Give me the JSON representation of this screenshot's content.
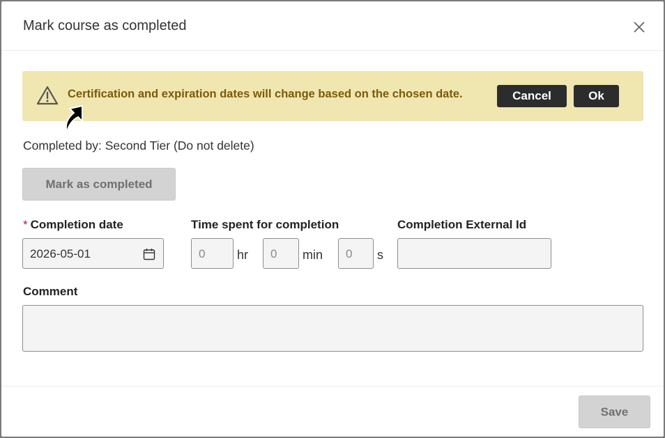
{
  "dialog": {
    "title": "Mark course as completed",
    "close_icon": "close-icon"
  },
  "alert": {
    "icon": "warning-triangle-icon",
    "message": "Certification and expiration dates will change based on the chosen date.",
    "cancel_label": "Cancel",
    "ok_label": "Ok",
    "background_color": "#f0e6b0",
    "text_color": "#7a5b08"
  },
  "completed_by": "Completed by: Second Tier (Do not delete)",
  "mark_completed_label": "Mark as completed",
  "completion_date": {
    "required_marker": "*",
    "label": "Completion date",
    "value": "2026-05-01",
    "icon": "calendar-icon"
  },
  "time_spent": {
    "label": "Time spent for completion",
    "hours": {
      "placeholder": "0",
      "unit": "hr"
    },
    "minutes": {
      "placeholder": "0",
      "unit": "min"
    },
    "seconds": {
      "placeholder": "0",
      "unit": "s"
    }
  },
  "external_id": {
    "label": "Completion External Id",
    "value": ""
  },
  "comment": {
    "label": "Comment",
    "value": ""
  },
  "footer": {
    "save_label": "Save"
  }
}
